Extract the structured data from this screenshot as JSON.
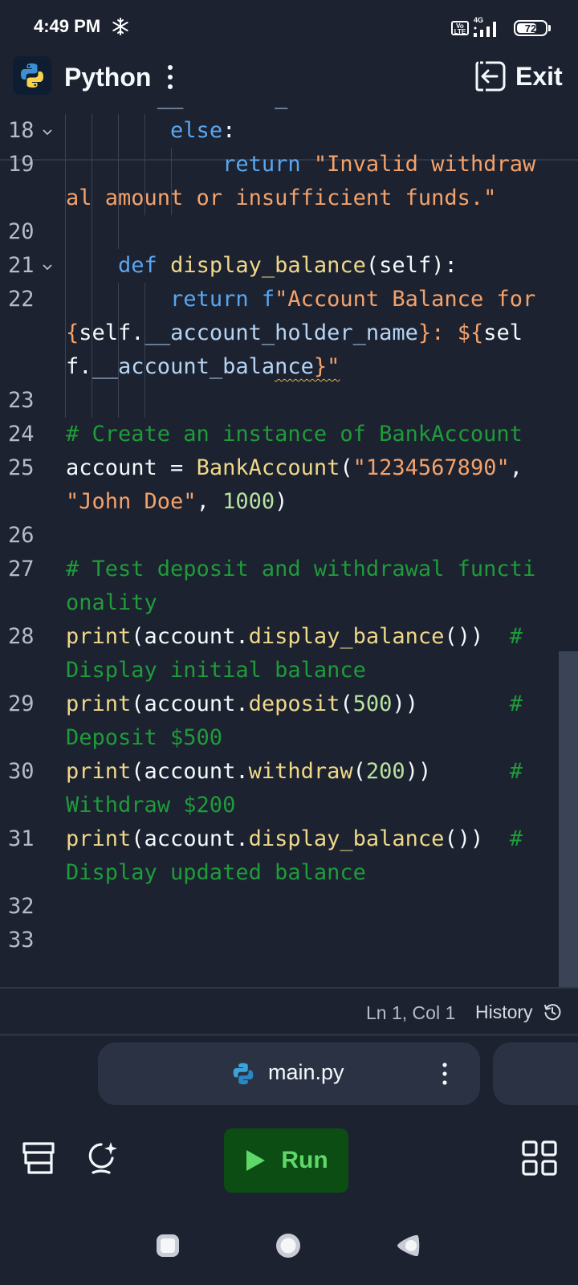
{
  "status_bar": {
    "time": "4:49 PM",
    "volte": "Vo LTE",
    "network": "4G",
    "battery_level": "72",
    "battery_fraction": 0.72
  },
  "header": {
    "title": "Python",
    "exit_label": "Exit"
  },
  "editor": {
    "lines": [
      {
        "number": "",
        "fold": false,
        "indent": 0,
        "tokens": [
          {
            "t": "string",
            "v": "${"
          },
          {
            "t": "default",
            "v": "self"
          },
          {
            "t": "punct",
            "v": "."
          },
          {
            "t": "prop",
            "v": "__account_balance"
          },
          {
            "t": "string",
            "v": "}"
          }
        ]
      },
      {
        "number": "18",
        "fold": true,
        "indent": 4,
        "tokens": [
          {
            "t": "keyword",
            "v": "        else"
          },
          {
            "t": "punct",
            "v": ":"
          }
        ]
      },
      {
        "number": "19",
        "fold": false,
        "indent": 5,
        "tokens": [
          {
            "t": "keyword",
            "v": "            return "
          },
          {
            "t": "string",
            "v": "\"Invalid withdrawal amount or insufficient funds.\""
          }
        ]
      },
      {
        "number": "20",
        "fold": false,
        "indent": 3,
        "tokens": []
      },
      {
        "number": "21",
        "fold": true,
        "indent": 2,
        "tokens": [
          {
            "t": "keyword",
            "v": "    def "
          },
          {
            "t": "func",
            "v": "display_balance"
          },
          {
            "t": "punct",
            "v": "("
          },
          {
            "t": "default",
            "v": "self"
          },
          {
            "t": "punct",
            "v": "):"
          }
        ]
      },
      {
        "number": "22",
        "fold": false,
        "indent": 4,
        "tokens": [
          {
            "t": "keyword",
            "v": "        return "
          },
          {
            "t": "keyword",
            "v": "f"
          },
          {
            "t": "string",
            "v": "\"Account Balance for "
          },
          {
            "t": "string",
            "v": "{"
          },
          {
            "t": "default",
            "v": "self"
          },
          {
            "t": "punct",
            "v": "."
          },
          {
            "t": "prop",
            "v": "__account_holder_name"
          },
          {
            "t": "string",
            "v": "}: ${"
          },
          {
            "t": "default",
            "v": "self"
          },
          {
            "t": "punct",
            "v": "."
          },
          {
            "t": "prop",
            "v": "__account_bala"
          },
          {
            "t": "prop",
            "v": "nce",
            "squiggle": true
          },
          {
            "t": "string",
            "v": "}\"",
            "squiggle": true
          }
        ]
      },
      {
        "number": "23",
        "fold": false,
        "indent": 4,
        "tokens": []
      },
      {
        "number": "24",
        "fold": false,
        "indent": 0,
        "tokens": [
          {
            "t": "comment",
            "v": "# Create an instance of BankAccount"
          }
        ]
      },
      {
        "number": "25",
        "fold": false,
        "indent": 0,
        "tokens": [
          {
            "t": "default",
            "v": "account "
          },
          {
            "t": "punct",
            "v": "= "
          },
          {
            "t": "func",
            "v": "BankAccount"
          },
          {
            "t": "punct",
            "v": "("
          },
          {
            "t": "string",
            "v": "\"1234567890\""
          },
          {
            "t": "punct",
            "v": ", "
          },
          {
            "t": "string",
            "v": "\"John Doe\""
          },
          {
            "t": "punct",
            "v": ", "
          },
          {
            "t": "number",
            "v": "1000"
          },
          {
            "t": "punct",
            "v": ")"
          }
        ]
      },
      {
        "number": "26",
        "fold": false,
        "indent": 0,
        "tokens": []
      },
      {
        "number": "27",
        "fold": false,
        "indent": 0,
        "tokens": [
          {
            "t": "comment",
            "v": "# Test deposit and withdrawal functionality"
          }
        ]
      },
      {
        "number": "28",
        "fold": false,
        "indent": 0,
        "tokens": [
          {
            "t": "func",
            "v": "print"
          },
          {
            "t": "punct",
            "v": "("
          },
          {
            "t": "default",
            "v": "account"
          },
          {
            "t": "punct",
            "v": "."
          },
          {
            "t": "func",
            "v": "display_balance"
          },
          {
            "t": "punct",
            "v": "())  "
          },
          {
            "t": "comment",
            "v": "# Display initial balance"
          }
        ]
      },
      {
        "number": "29",
        "fold": false,
        "indent": 0,
        "tokens": [
          {
            "t": "func",
            "v": "print"
          },
          {
            "t": "punct",
            "v": "("
          },
          {
            "t": "default",
            "v": "account"
          },
          {
            "t": "punct",
            "v": "."
          },
          {
            "t": "func",
            "v": "deposit"
          },
          {
            "t": "punct",
            "v": "("
          },
          {
            "t": "number",
            "v": "500"
          },
          {
            "t": "punct",
            "v": "))       "
          },
          {
            "t": "comment",
            "v": "# Deposit $500"
          }
        ]
      },
      {
        "number": "30",
        "fold": false,
        "indent": 0,
        "tokens": [
          {
            "t": "func",
            "v": "print"
          },
          {
            "t": "punct",
            "v": "("
          },
          {
            "t": "default",
            "v": "account"
          },
          {
            "t": "punct",
            "v": "."
          },
          {
            "t": "func",
            "v": "withdraw"
          },
          {
            "t": "punct",
            "v": "("
          },
          {
            "t": "number",
            "v": "200"
          },
          {
            "t": "punct",
            "v": "))      "
          },
          {
            "t": "comment",
            "v": "# Withdraw $200"
          }
        ]
      },
      {
        "number": "31",
        "fold": false,
        "indent": 0,
        "tokens": [
          {
            "t": "func",
            "v": "print"
          },
          {
            "t": "punct",
            "v": "("
          },
          {
            "t": "default",
            "v": "account"
          },
          {
            "t": "punct",
            "v": "."
          },
          {
            "t": "func",
            "v": "display_balance"
          },
          {
            "t": "punct",
            "v": "())  "
          },
          {
            "t": "comment",
            "v": "# Display updated balance"
          }
        ]
      },
      {
        "number": "32",
        "fold": false,
        "indent": 0,
        "tokens": []
      },
      {
        "number": "33",
        "fold": false,
        "indent": 0,
        "tokens": []
      }
    ]
  },
  "editor_status": {
    "cursor": "Ln 1, Col 1",
    "history_label": "History"
  },
  "file_tab": {
    "name": "main.py"
  },
  "toolbar": {
    "run_label": "Run",
    "icons": [
      "layers-icon",
      "ai-assistant-icon",
      "grid-apps-icon"
    ]
  },
  "colors": {
    "background": "#1c2230",
    "keyword": "#5aa6f0",
    "string": "#f5a26a",
    "function": "#f0d889",
    "number": "#b8e2a0",
    "comment": "#1f9b3a",
    "run_button": "#0b4d12",
    "run_text": "#5fd86a"
  }
}
